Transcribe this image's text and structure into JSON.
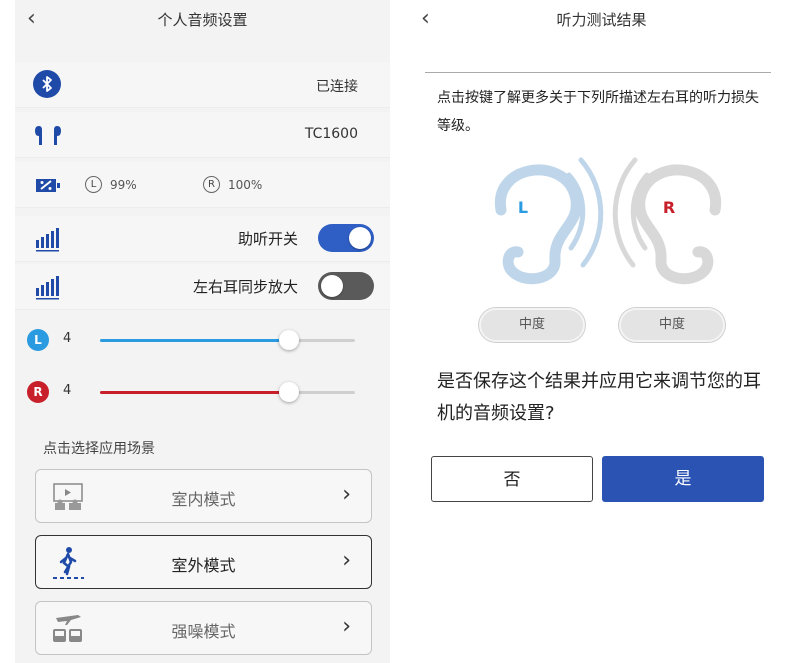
{
  "left": {
    "title": "个人音频设置",
    "bluetooth_status": "已连接",
    "device_model": "TC1600",
    "battery": {
      "left_label": "L",
      "left_value": "99%",
      "right_label": "R",
      "right_value": "100%"
    },
    "hearing_toggle": {
      "label": "助听开关",
      "on": true
    },
    "sync_toggle": {
      "label": "左右耳同步放大",
      "on": false
    },
    "left_slider": {
      "badge": "L",
      "value": "4",
      "level": 0.74,
      "color": "#2a9be0"
    },
    "right_slider": {
      "badge": "R",
      "value": "4",
      "level": 0.74,
      "color": "#c8202a"
    },
    "scene_section_label": "点击选择应用场景",
    "scenes": [
      {
        "label": "室内模式",
        "icon": "indoor-icon",
        "selected": false
      },
      {
        "label": "室外模式",
        "icon": "walking-person-icon",
        "selected": true
      },
      {
        "label": "强噪模式",
        "icon": "transport-icon",
        "selected": false
      }
    ]
  },
  "right": {
    "title": "听力测试结果",
    "info_text": "点击按键了解更多关于下列所描述左右耳的听力损失等级。",
    "left_ear": {
      "label": "L",
      "level": "中度",
      "color": "#2a9be0"
    },
    "right_ear": {
      "label": "R",
      "level": "中度",
      "color": "#c8202a"
    },
    "question": "是否保存这个结果并应用它来调节您的耳机的音频设置?",
    "no_label": "否",
    "yes_label": "是"
  },
  "colors": {
    "accent": "#2a53b4",
    "toggle_on": "#2f5fc4",
    "toggle_off": "#5a5a5a"
  }
}
